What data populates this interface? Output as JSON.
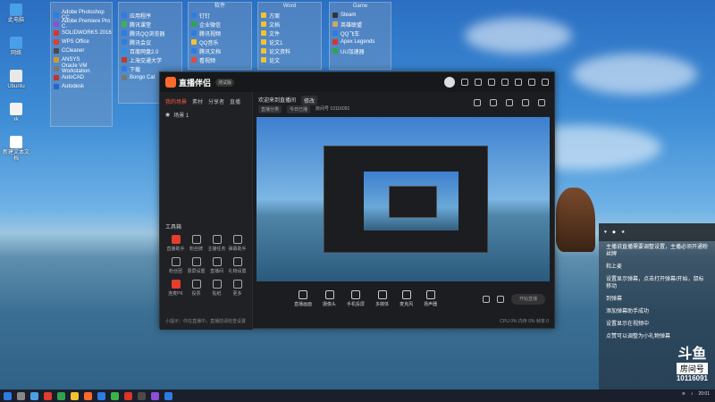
{
  "desktop_icons": [
    {
      "label": "此电脑",
      "color": "#4aa0e8"
    },
    {
      "label": "网络",
      "color": "#4aa0e8"
    },
    {
      "label": "Ubuntu",
      "color": "#e8e8e8"
    },
    {
      "label": "xk",
      "color": "#f3f3f3"
    },
    {
      "label": "新建文本文档",
      "color": "#ffffff"
    }
  ],
  "groups": [
    {
      "header": "",
      "items": [
        "Adobe Photoshop CC",
        "Adobe Premiere Pro C.",
        "SOLIDWORKS 2016",
        "WPS Office",
        "CCleaner",
        "ANSYS",
        "Oracle VM Workstation",
        "AutoCAD",
        "Autodesk"
      ],
      "colors": [
        "#2b7de1",
        "#8a4fd8",
        "#d9352b",
        "#e03c31",
        "#4a4a4a",
        "#d19a2a",
        "#777",
        "#c2332a",
        "#2266cc"
      ]
    },
    {
      "header": "",
      "items": [
        "应用程序",
        "腾讯课堂",
        "腾讯QQ浏览器",
        "腾讯会议",
        "百度网盘2.0",
        "上海交通大学",
        "下载",
        "Bongo Cat"
      ],
      "colors": [
        "#2e7be4",
        "#3ab54a",
        "#2b7de1",
        "#2e7be4",
        "#2b90e8",
        "#c0392b",
        "#2e7be4",
        "#777"
      ]
    },
    {
      "header": "软件",
      "items": [
        "钉钉",
        "企业微信",
        "腾讯视频",
        "QQ音乐",
        "腾讯文档",
        "看视频"
      ],
      "colors": [
        "#2b7de1",
        "#2ea44f",
        "#2e7be4",
        "#f2c230",
        "#2e7be4",
        "#e84a3a"
      ]
    },
    {
      "header": "Word",
      "items": [
        "方案",
        "文档",
        "文件",
        "论文1",
        "论文资料",
        "论文"
      ],
      "colors": [
        "#f2c230",
        "#f2c230",
        "#f2c230",
        "#f2c230",
        "#f2c230",
        "#f2c230"
      ]
    },
    {
      "header": "Game",
      "items": [
        "Steam",
        "英雄联盟",
        "QQ飞车",
        "Apex Legends",
        "UU加速器"
      ],
      "colors": [
        "#333",
        "#c8aa6e",
        "#2e7be4",
        "#d9352b",
        "#2ea44f"
      ]
    }
  ],
  "app": {
    "logo": "直播伴侣",
    "version": "测试版",
    "tabs": [
      "我的场景",
      "素材",
      "分享者",
      "直播"
    ],
    "scene": "场景 1",
    "stream_title": "欢迎来到直播间",
    "stream_tag": "修改",
    "meta": [
      "直播分类",
      "今日已播",
      "房间号 10116091"
    ],
    "tools_label": "工具箱",
    "tools": [
      {
        "label": "直播助手",
        "red": true
      },
      {
        "label": "粉丝牌",
        "red": false
      },
      {
        "label": "主播任务",
        "red": false
      },
      {
        "label": "弹幕助手",
        "red": false
      },
      {
        "label": "粉丝团",
        "red": false
      },
      {
        "label": "录屏设置",
        "red": false
      },
      {
        "label": "直播间",
        "red": false
      },
      {
        "label": "礼物设置",
        "red": false
      },
      {
        "label": "连麦PK",
        "red": true
      },
      {
        "label": "投票",
        "red": false
      },
      {
        "label": "贴纸",
        "red": false
      },
      {
        "label": "更多",
        "red": false
      }
    ],
    "controls": [
      "直播画面",
      "摄像头",
      "手机投屏",
      "多媒体",
      "麦克风",
      "扬声器"
    ],
    "go_live": "开始直播",
    "status_left": "小提示：你在直播中，直播前请检查设置",
    "status_right": "CPU 0%  内存 0%  帧率 0"
  },
  "overlay": {
    "lines": [
      "主播说直播需要调整设置，主播必须开通粉丝牌",
      "和上麦",
      "设置显示弹幕，点击打开弹幕/开始，鼠标移动",
      "到弹幕",
      "添加弹幕助手成功",
      "设置显示在视频中",
      "点赞可以调整为小礼物弹幕"
    ],
    "brand": "斗鱼",
    "room_label": "房间号",
    "room_id": "10116091"
  },
  "taskbar": {
    "time": "20:01",
    "icons": [
      "#2e7be4",
      "#888",
      "#4aa0e8",
      "#e03c31",
      "#2ea44f",
      "#f2c230",
      "#ff6a2c",
      "#2b7de1",
      "#3ab54a",
      "#d9352b",
      "#4a4a4a",
      "#8a4fd8",
      "#2e7be4"
    ]
  }
}
